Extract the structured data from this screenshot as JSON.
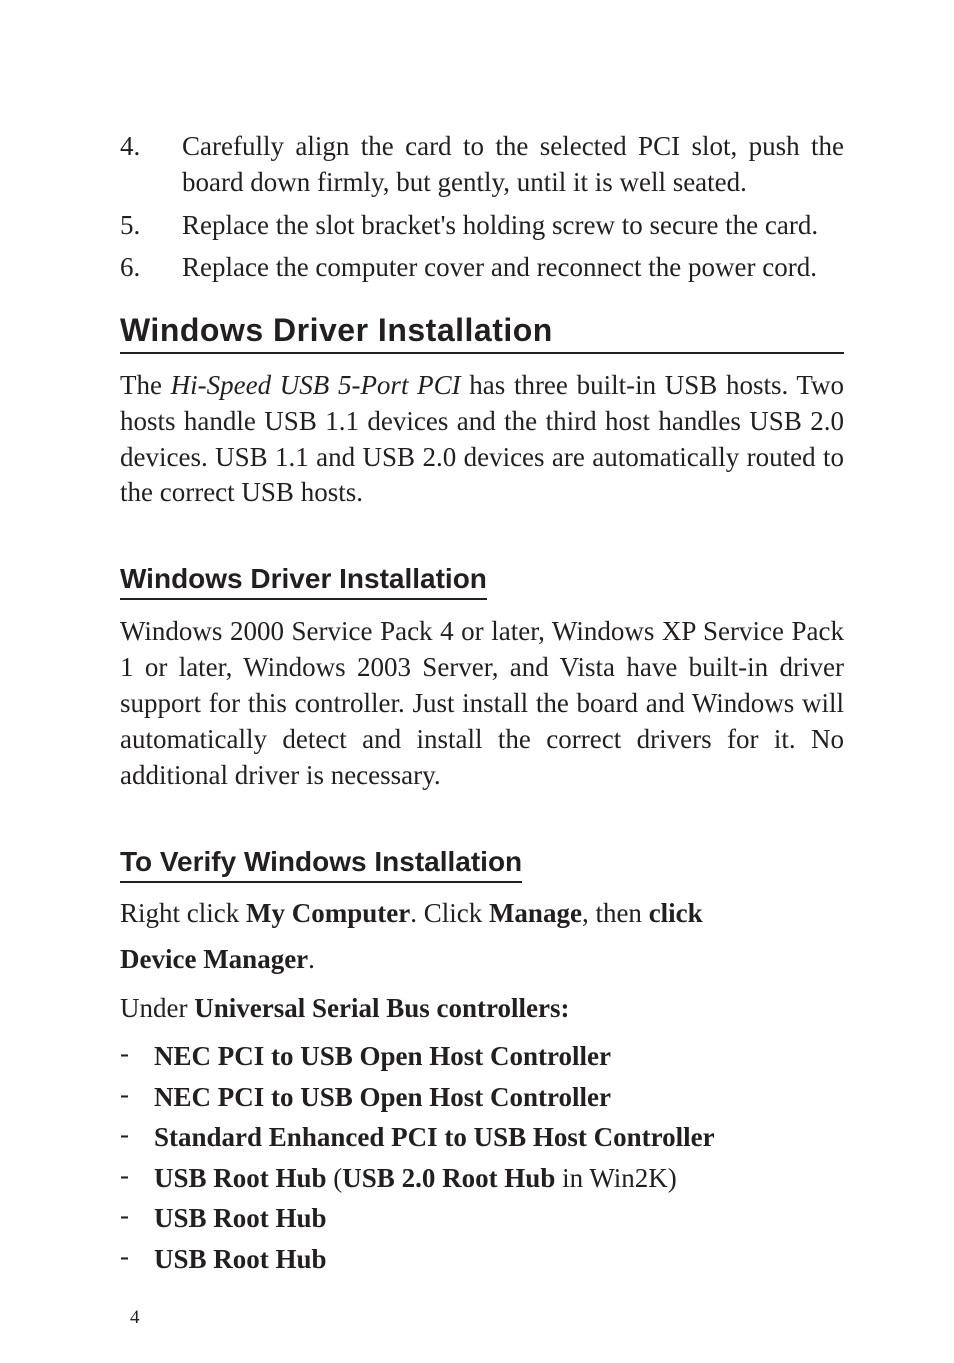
{
  "steps": [
    {
      "num": "4.",
      "text_before": "Carefully align the card to the selected PCI slot, push the board down firmly, but gently, until it is well seated."
    },
    {
      "num": "5.",
      "text_before": "Replace the slot bracket's holding screw to secure the card."
    },
    {
      "num": "6.",
      "text_before": "Replace the computer cover and reconnect the power cord."
    }
  ],
  "h1": "Windows  Driver  Installation",
  "p1_a": "The ",
  "p1_i": "Hi-Speed USB 5-Port PCI",
  "p1_b": " has three built-in USB hosts. Two hosts handle USB 1.1 devices and the third host handles USB 2.0 devices.  USB 1.1 and USB 2.0 devices are automatically routed to the correct USB hosts.",
  "h2a": "Windows Driver Installation",
  "p2": "Windows 2000 Service Pack 4 or later, Windows XP Service Pack 1 or later, Windows 2003 Server, and Vista have built-in driver support for this controller.  Just install the board and Windows will automatically detect and install the correct drivers for it.  No additional driver is necessary.",
  "h2b": "To Verify Windows Installation",
  "verify1_a": "Right click ",
  "verify1_b": "My Computer",
  "verify1_c": ". Click ",
  "verify1_d": "Manage",
  "verify1_e": ", then ",
  "verify1_f": "click",
  "verify2_a": "Device Manager",
  "verify2_b": ".",
  "verify3_a": "Under ",
  "verify3_b": "Universal Serial Bus controllers:",
  "bullets": {
    "b1": "NEC PCI to USB Open Host Controller",
    "b2": "NEC PCI to USB Open Host Controller",
    "b3": "Standard Enhanced PCI to USB Host Controller",
    "b4a": "USB Root Hub",
    "b4b": " (",
    "b4c": "USB 2.0 Root Hub",
    "b4d": " in Win2K)",
    "b5": "USB Root Hub",
    "b6": "USB Root Hub"
  },
  "dash": "-",
  "page": "4"
}
